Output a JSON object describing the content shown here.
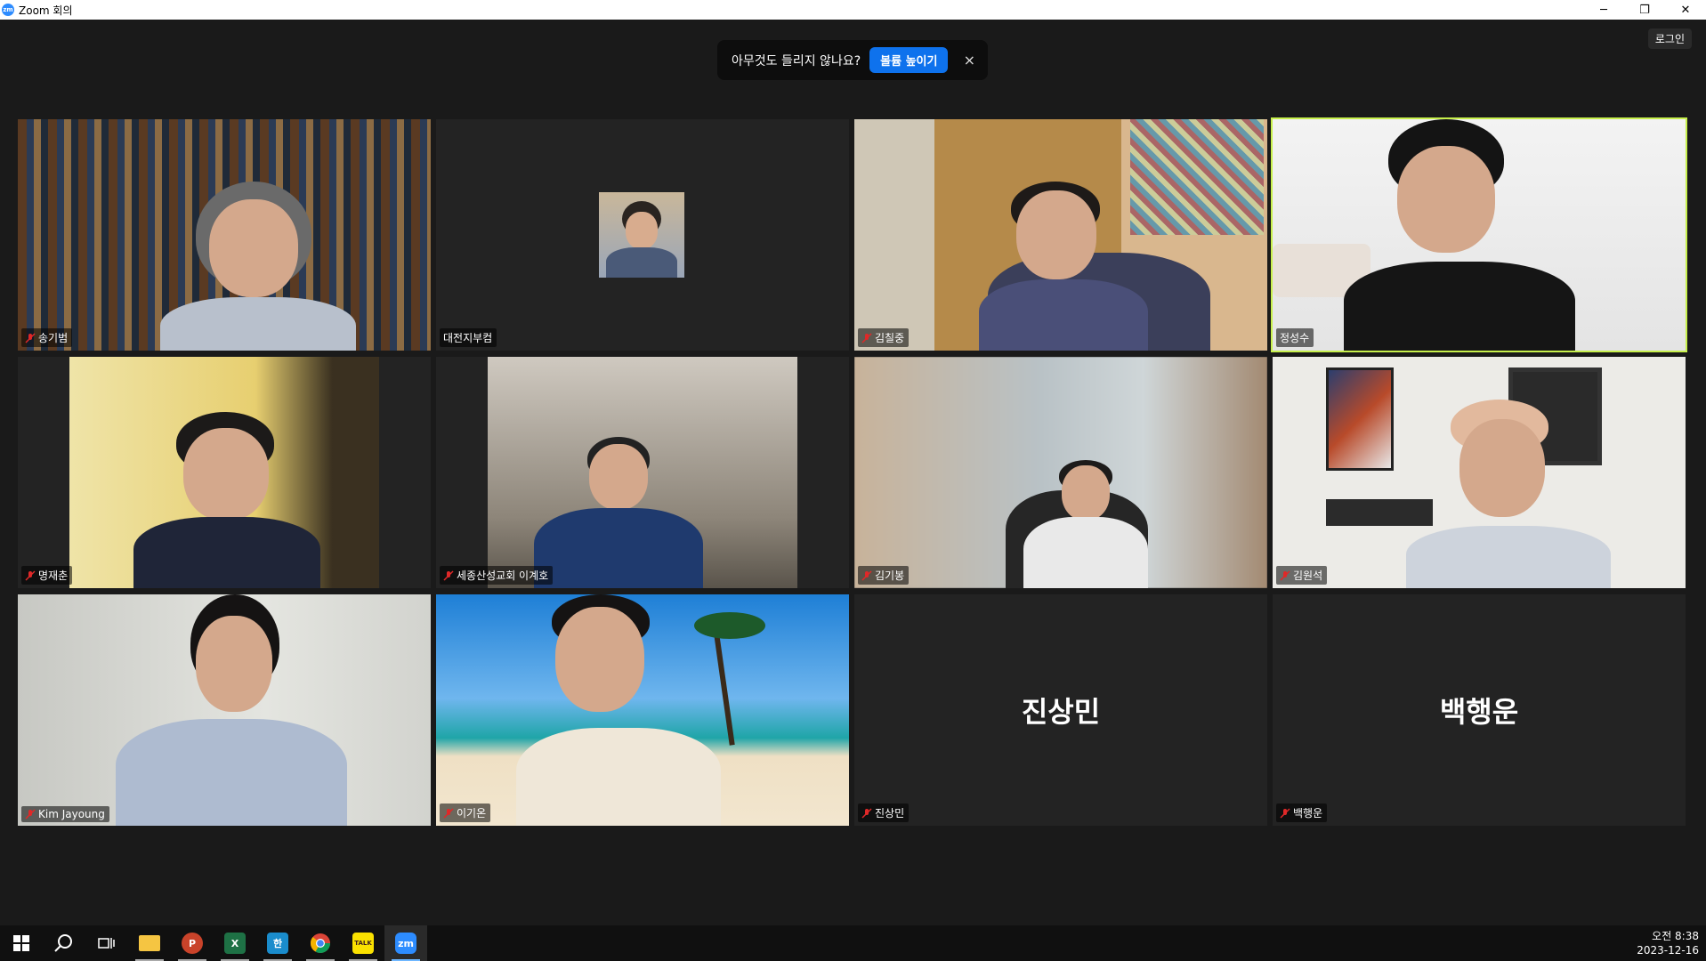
{
  "window": {
    "title": "Zoom 회의",
    "app_icon_text": "zm",
    "controls": [
      "─",
      "❐",
      "✕"
    ]
  },
  "signin_label": "로그인",
  "toast": {
    "message": "아무것도 들리지 않나요?",
    "button": "볼륨 높이기",
    "close": "×"
  },
  "participants": [
    {
      "name": "송기범",
      "muted": true,
      "video": true
    },
    {
      "name": "대전지부컴",
      "muted": false,
      "video": false,
      "thumbnail": true
    },
    {
      "name": "김칠중",
      "muted": true,
      "video": true
    },
    {
      "name": "정성수",
      "muted": false,
      "video": true,
      "active_speaker": true
    },
    {
      "name": "명재춘",
      "muted": true,
      "video": true
    },
    {
      "name": "세종산성교회 이계호",
      "muted": true,
      "video": true
    },
    {
      "name": "김기봉",
      "muted": true,
      "video": true
    },
    {
      "name": "김원석",
      "muted": true,
      "video": true
    },
    {
      "name": "Kim Jayoung",
      "muted": true,
      "video": true
    },
    {
      "name": "이기온",
      "muted": true,
      "video": true
    },
    {
      "name": "진상민",
      "muted": true,
      "video": false
    },
    {
      "name": "백행운",
      "muted": true,
      "video": false
    }
  ],
  "big_names": {
    "t10": "진상민",
    "t11": "백행운"
  },
  "taskbar": {
    "icons": [
      "windows-start-icon",
      "search-icon",
      "task-view-icon",
      "file-explorer-icon",
      "powerpoint-icon",
      "excel-icon",
      "hancom-icon",
      "chrome-icon",
      "kakaotalk-icon",
      "zoom-icon"
    ],
    "labels": {
      "ppt": "P",
      "xls": "X",
      "han": "한",
      "kakao": "TALK",
      "zoom": "zm"
    },
    "clock_time": "오전 8:38",
    "clock_date": "2023-12-16"
  },
  "colors": {
    "active_speaker_border": "#c7f04c",
    "toast_button": "#0e72ed",
    "zoom_blue": "#2d8cff"
  }
}
